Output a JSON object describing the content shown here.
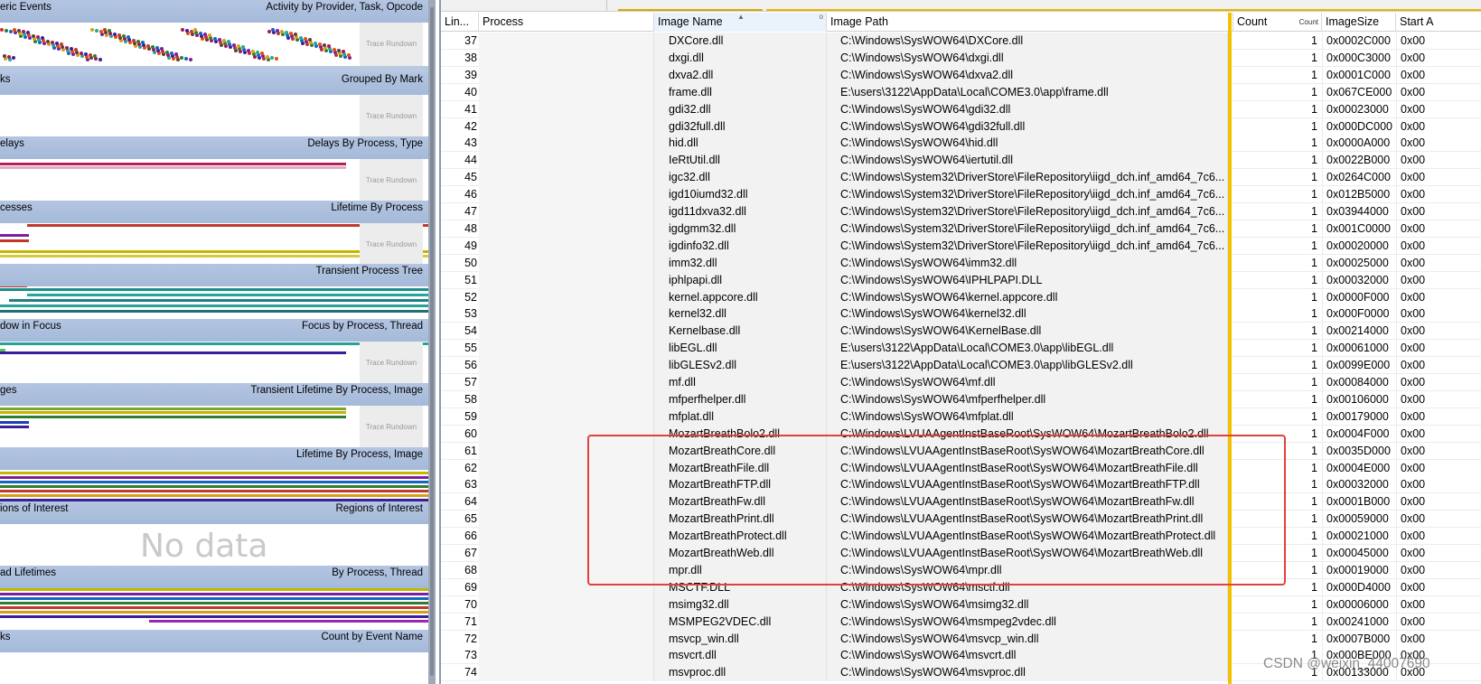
{
  "graph_sections": [
    {
      "title": "eric Events",
      "view": "Activity by Provider, Task, Opcode",
      "badge": "Trace Rundown"
    },
    {
      "title": "ks",
      "view": "Grouped By Mark",
      "badge": "Trace Rundown"
    },
    {
      "title": "elays",
      "view": "Delays By Process, Type",
      "badge": "Trace Rundown"
    },
    {
      "title": "cesses",
      "view": "Lifetime By Process",
      "badge": "Trace Rundown"
    },
    {
      "title": "",
      "view": "Transient Process Tree",
      "badge": ""
    },
    {
      "title": "dow in Focus",
      "view": "Focus by Process, Thread",
      "badge": "Trace Rundown"
    },
    {
      "title": "ges",
      "view": "Transient Lifetime By Process, Image",
      "badge": "Trace Rundown"
    },
    {
      "title": "",
      "view": "Lifetime By Process, Image",
      "badge": ""
    },
    {
      "title": "ions of Interest",
      "view": "Regions of Interest",
      "badge": "",
      "nodata": "No data"
    },
    {
      "title": "ad Lifetimes",
      "view": "By Process, Thread",
      "badge": ""
    },
    {
      "title": "ks",
      "view": "Count by Event Name",
      "badge": ""
    }
  ],
  "table": {
    "columns": {
      "line": "Lin...",
      "process": "Process",
      "image_name": "Image Name",
      "image_path": "Image Path",
      "count": "Count",
      "count_sub": "Count",
      "image_size": "ImageSize",
      "start": "Start A"
    },
    "rows": [
      {
        "line": "37",
        "name": "DXCore.dll",
        "path": "C:\\Windows\\SysWOW64\\DXCore.dll",
        "count": "1",
        "size": "0x0002C000",
        "start": "0x00"
      },
      {
        "line": "38",
        "name": "dxgi.dll",
        "path": "C:\\Windows\\SysWOW64\\dxgi.dll",
        "count": "1",
        "size": "0x000C3000",
        "start": "0x00"
      },
      {
        "line": "39",
        "name": "dxva2.dll",
        "path": "C:\\Windows\\SysWOW64\\dxva2.dll",
        "count": "1",
        "size": "0x0001C000",
        "start": "0x00"
      },
      {
        "line": "40",
        "name": "frame.dll",
        "path": "E:\\users\\3122\\AppData\\Local\\COME3.0\\app\\frame.dll",
        "count": "1",
        "size": "0x067CE000",
        "start": "0x00"
      },
      {
        "line": "41",
        "name": "gdi32.dll",
        "path": "C:\\Windows\\SysWOW64\\gdi32.dll",
        "count": "1",
        "size": "0x00023000",
        "start": "0x00"
      },
      {
        "line": "42",
        "name": "gdi32full.dll",
        "path": "C:\\Windows\\SysWOW64\\gdi32full.dll",
        "count": "1",
        "size": "0x000DC000",
        "start": "0x00"
      },
      {
        "line": "43",
        "name": "hid.dll",
        "path": "C:\\Windows\\SysWOW64\\hid.dll",
        "count": "1",
        "size": "0x0000A000",
        "start": "0x00"
      },
      {
        "line": "44",
        "name": "IeRtUtil.dll",
        "path": "C:\\Windows\\SysWOW64\\iertutil.dll",
        "count": "1",
        "size": "0x0022B000",
        "start": "0x00"
      },
      {
        "line": "45",
        "name": "igc32.dll",
        "path": "C:\\Windows\\System32\\DriverStore\\FileRepository\\iigd_dch.inf_amd64_7c6...",
        "count": "1",
        "size": "0x0264C000",
        "start": "0x00"
      },
      {
        "line": "46",
        "name": "igd10iumd32.dll",
        "path": "C:\\Windows\\System32\\DriverStore\\FileRepository\\iigd_dch.inf_amd64_7c6...",
        "count": "1",
        "size": "0x012B5000",
        "start": "0x00"
      },
      {
        "line": "47",
        "name": "igd11dxva32.dll",
        "path": "C:\\Windows\\System32\\DriverStore\\FileRepository\\iigd_dch.inf_amd64_7c6...",
        "count": "1",
        "size": "0x03944000",
        "start": "0x00"
      },
      {
        "line": "48",
        "name": "igdgmm32.dll",
        "path": "C:\\Windows\\System32\\DriverStore\\FileRepository\\iigd_dch.inf_amd64_7c6...",
        "count": "1",
        "size": "0x001C0000",
        "start": "0x00"
      },
      {
        "line": "49",
        "name": "igdinfo32.dll",
        "path": "C:\\Windows\\System32\\DriverStore\\FileRepository\\iigd_dch.inf_amd64_7c6...",
        "count": "1",
        "size": "0x00020000",
        "start": "0x00"
      },
      {
        "line": "50",
        "name": "imm32.dll",
        "path": "C:\\Windows\\SysWOW64\\imm32.dll",
        "count": "1",
        "size": "0x00025000",
        "start": "0x00"
      },
      {
        "line": "51",
        "name": "iphlpapi.dll",
        "path": "C:\\Windows\\SysWOW64\\IPHLPAPI.DLL",
        "count": "1",
        "size": "0x00032000",
        "start": "0x00"
      },
      {
        "line": "52",
        "name": "kernel.appcore.dll",
        "path": "C:\\Windows\\SysWOW64\\kernel.appcore.dll",
        "count": "1",
        "size": "0x0000F000",
        "start": "0x00"
      },
      {
        "line": "53",
        "name": "kernel32.dll",
        "path": "C:\\Windows\\SysWOW64\\kernel32.dll",
        "count": "1",
        "size": "0x000F0000",
        "start": "0x00"
      },
      {
        "line": "54",
        "name": "Kernelbase.dll",
        "path": "C:\\Windows\\SysWOW64\\KernelBase.dll",
        "count": "1",
        "size": "0x00214000",
        "start": "0x00"
      },
      {
        "line": "55",
        "name": "libEGL.dll",
        "path": "E:\\users\\3122\\AppData\\Local\\COME3.0\\app\\libEGL.dll",
        "count": "1",
        "size": "0x00061000",
        "start": "0x00"
      },
      {
        "line": "56",
        "name": "libGLESv2.dll",
        "path": "E:\\users\\3122\\AppData\\Local\\COME3.0\\app\\libGLESv2.dll",
        "count": "1",
        "size": "0x0099E000",
        "start": "0x00"
      },
      {
        "line": "57",
        "name": "mf.dll",
        "path": "C:\\Windows\\SysWOW64\\mf.dll",
        "count": "1",
        "size": "0x00084000",
        "start": "0x00"
      },
      {
        "line": "58",
        "name": "mfperfhelper.dll",
        "path": "C:\\Windows\\SysWOW64\\mfperfhelper.dll",
        "count": "1",
        "size": "0x00106000",
        "start": "0x00"
      },
      {
        "line": "59",
        "name": "mfplat.dll",
        "path": "C:\\Windows\\SysWOW64\\mfplat.dll",
        "count": "1",
        "size": "0x00179000",
        "start": "0x00"
      },
      {
        "line": "60",
        "name": "MozartBreathBolo2.dll",
        "path": "C:\\Windows\\LVUAAgentInstBaseRoot\\SysWOW64\\MozartBreathBolo2.dll",
        "count": "1",
        "size": "0x0004F000",
        "start": "0x00"
      },
      {
        "line": "61",
        "name": "MozartBreathCore.dll",
        "path": "C:\\Windows\\LVUAAgentInstBaseRoot\\SysWOW64\\MozartBreathCore.dll",
        "count": "1",
        "size": "0x0035D000",
        "start": "0x00"
      },
      {
        "line": "62",
        "name": "MozartBreathFile.dll",
        "path": "C:\\Windows\\LVUAAgentInstBaseRoot\\SysWOW64\\MozartBreathFile.dll",
        "count": "1",
        "size": "0x0004E000",
        "start": "0x00"
      },
      {
        "line": "63",
        "name": "MozartBreathFTP.dll",
        "path": "C:\\Windows\\LVUAAgentInstBaseRoot\\SysWOW64\\MozartBreathFTP.dll",
        "count": "1",
        "size": "0x00032000",
        "start": "0x00"
      },
      {
        "line": "64",
        "name": "MozartBreathFw.dll",
        "path": "C:\\Windows\\LVUAAgentInstBaseRoot\\SysWOW64\\MozartBreathFw.dll",
        "count": "1",
        "size": "0x0001B000",
        "start": "0x00"
      },
      {
        "line": "65",
        "name": "MozartBreathPrint.dll",
        "path": "C:\\Windows\\LVUAAgentInstBaseRoot\\SysWOW64\\MozartBreathPrint.dll",
        "count": "1",
        "size": "0x00059000",
        "start": "0x00"
      },
      {
        "line": "66",
        "name": "MozartBreathProtect.dll",
        "path": "C:\\Windows\\LVUAAgentInstBaseRoot\\SysWOW64\\MozartBreathProtect.dll",
        "count": "1",
        "size": "0x00021000",
        "start": "0x00"
      },
      {
        "line": "67",
        "name": "MozartBreathWeb.dll",
        "path": "C:\\Windows\\LVUAAgentInstBaseRoot\\SysWOW64\\MozartBreathWeb.dll",
        "count": "1",
        "size": "0x00045000",
        "start": "0x00"
      },
      {
        "line": "68",
        "name": "mpr.dll",
        "path": "C:\\Windows\\SysWOW64\\mpr.dll",
        "count": "1",
        "size": "0x00019000",
        "start": "0x00"
      },
      {
        "line": "69",
        "name": "MSCTF.DLL",
        "path": "C:\\Windows\\SysWOW64\\msctf.dll",
        "count": "1",
        "size": "0x000D4000",
        "start": "0x00"
      },
      {
        "line": "70",
        "name": "msimg32.dll",
        "path": "C:\\Windows\\SysWOW64\\msimg32.dll",
        "count": "1",
        "size": "0x00006000",
        "start": "0x00"
      },
      {
        "line": "71",
        "name": "MSMPEG2VDEC.dll",
        "path": "C:\\Windows\\SysWOW64\\msmpeg2vdec.dll",
        "count": "1",
        "size": "0x00241000",
        "start": "0x00"
      },
      {
        "line": "72",
        "name": "msvcp_win.dll",
        "path": "C:\\Windows\\SysWOW64\\msvcp_win.dll",
        "count": "1",
        "size": "0x0007B000",
        "start": "0x00"
      },
      {
        "line": "73",
        "name": "msvcrt.dll",
        "path": "C:\\Windows\\SysWOW64\\msvcrt.dll",
        "count": "1",
        "size": "0x000BE000",
        "start": "0x00"
      },
      {
        "line": "74",
        "name": "msvproc.dll",
        "path": "C:\\Windows\\SysWOW64\\msvproc.dll",
        "count": "1",
        "size": "0x00133000",
        "start": "0x00"
      }
    ]
  },
  "watermark": "CSDN @weixin_44007690",
  "colors": {
    "panel_bg": "#b9c9e2",
    "highlight": "#e0413c",
    "divider": "#f3c100"
  }
}
